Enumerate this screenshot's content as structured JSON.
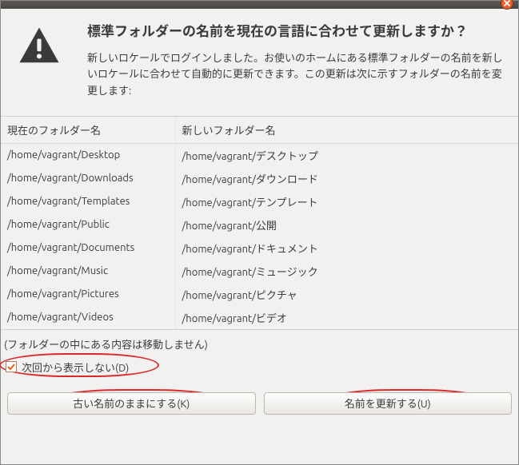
{
  "dialog": {
    "title": "標準フォルダーの名前を現在の言語に合わせて更新しますか？",
    "description": "新しいロケールでログインしました。お使いのホームにある標準フォルダーの名前を新しいロケールに合わせて自動的に更新できます。この更新は次に示すフォルダーの名前を変更します:"
  },
  "table": {
    "headers": [
      "現在のフォルダー名",
      "新しいフォルダー名"
    ],
    "rows": [
      [
        "/home/vagrant/Desktop",
        "/home/vagrant/デスクトップ"
      ],
      [
        "/home/vagrant/Downloads",
        "/home/vagrant/ダウンロード"
      ],
      [
        "/home/vagrant/Templates",
        "/home/vagrant/テンプレート"
      ],
      [
        "/home/vagrant/Public",
        "/home/vagrant/公開"
      ],
      [
        "/home/vagrant/Documents",
        "/home/vagrant/ドキュメント"
      ],
      [
        "/home/vagrant/Music",
        "/home/vagrant/ミュージック"
      ],
      [
        "/home/vagrant/Pictures",
        "/home/vagrant/ピクチャ"
      ],
      [
        "/home/vagrant/Videos",
        "/home/vagrant/ビデオ"
      ]
    ]
  },
  "note": "(フォルダーの中にある内容は移動しません)",
  "checkbox": {
    "label": "次回から表示しない(D)",
    "checked": true
  },
  "buttons": {
    "keep": "古い名前のままにする(K)",
    "update": "名前を更新する(U)"
  }
}
